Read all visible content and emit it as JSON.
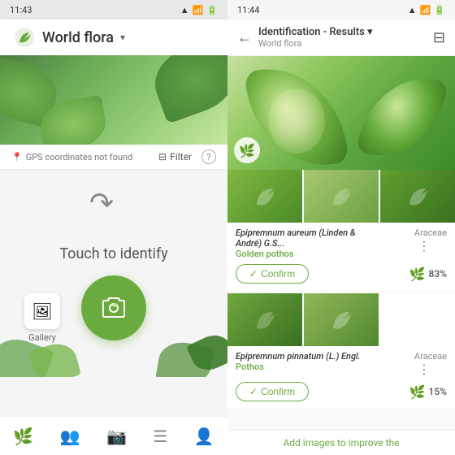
{
  "left": {
    "status_bar": {
      "time": "11:43",
      "icons": [
        "signal",
        "wifi",
        "battery"
      ]
    },
    "header": {
      "title": "World flora",
      "dropdown": "▾"
    },
    "toolbar": {
      "gps": "GPS coordinates not found",
      "filter": "Filter",
      "help": "?"
    },
    "camera_area": {
      "hint": "Touch to identify"
    },
    "gallery": {
      "label": "Gallery"
    },
    "nav": [
      {
        "label": "leaf",
        "active": false
      },
      {
        "label": "people",
        "active": false
      },
      {
        "label": "camera",
        "active": true
      },
      {
        "label": "list",
        "active": false
      },
      {
        "label": "person",
        "active": false
      }
    ]
  },
  "right": {
    "status_bar": {
      "time": "11:44",
      "icons": [
        "signal",
        "wifi",
        "battery"
      ]
    },
    "header": {
      "back": "←",
      "title": "Identification - Results ▾",
      "subtitle": "World flora",
      "filter": "⊟"
    },
    "results": [
      {
        "scientific": "Epipremnum aureum (Linden & André) G.S...",
        "common": "Golden pothos",
        "family": "Araceae",
        "confirm": "Confirm",
        "score": "83%"
      },
      {
        "scientific": "Epipremnum pinnatum (L.) Engl.",
        "common": "Pothos",
        "family": "Araceae",
        "confirm": "Confirm",
        "score": "15%"
      }
    ],
    "add_images": "Add images to improve the"
  }
}
